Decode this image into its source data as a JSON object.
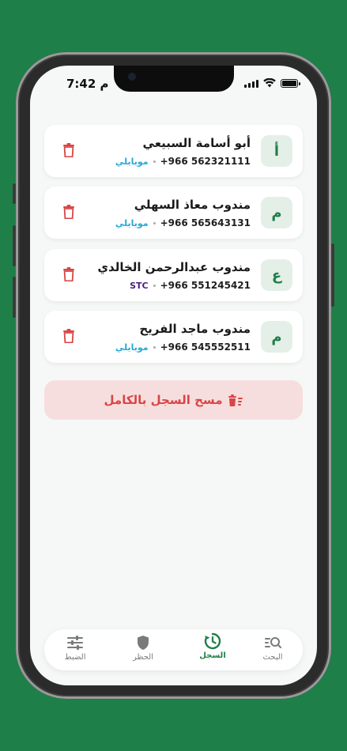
{
  "status": {
    "time": "7:42 م"
  },
  "entries": [
    {
      "avatar": "أ",
      "name": "أبو أسامة السبيعي",
      "phone": "+966 562321111",
      "carrier": "موبايلي",
      "carrier_color": "#27a9d6"
    },
    {
      "avatar": "م",
      "name": "مندوب معاذ السهلي",
      "phone": "+966 565643131",
      "carrier": "موبايلي",
      "carrier_color": "#27a9d6"
    },
    {
      "avatar": "ع",
      "name": "مندوب عبدالرحمن الخالدي",
      "phone": "+966 551245421",
      "carrier": "STC",
      "carrier_color": "#4b1f7d"
    },
    {
      "avatar": "م",
      "name": "مندوب ماجد الفريح",
      "phone": "+966 545552511",
      "carrier": "موبايلي",
      "carrier_color": "#27a9d6"
    }
  ],
  "clear_all_label": "مسح السجل بالكامل",
  "tabs": [
    {
      "label": "البحث",
      "icon": "search-list-icon"
    },
    {
      "label": "السجل",
      "icon": "history-icon",
      "active": true
    },
    {
      "label": "الحظر",
      "icon": "shield-icon"
    },
    {
      "label": "الضبط",
      "icon": "sliders-icon"
    }
  ],
  "colors": {
    "brand": "#1f7f48",
    "danger": "#d94545",
    "danger_bg": "#f7dede"
  }
}
